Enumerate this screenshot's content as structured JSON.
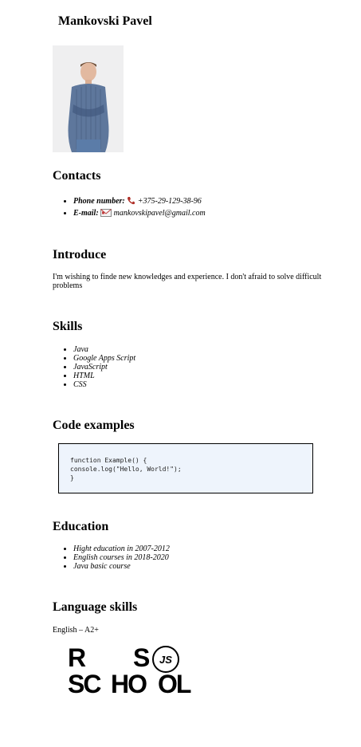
{
  "name": "Mankovski Pavel",
  "contacts": {
    "heading": "Contacts",
    "phone_label": "Phone number:",
    "phone_value": "+375-29-129-38-96",
    "email_label": "E-mail:",
    "email_value": "mankovskipavel@gmail.com"
  },
  "introduce": {
    "heading": "Introduce",
    "text": "I'm wishing to finde new knowledges and experience. I don't afraid to solve difficult problems"
  },
  "skills": {
    "heading": "Skills",
    "items": [
      "Java",
      "Google Apps Script",
      "JavaScript",
      "HTML",
      "CSS"
    ]
  },
  "code_examples": {
    "heading": "Code examples",
    "lines": [
      "function Example() {",
      "console.log(\"Hello, World!\");",
      "}"
    ]
  },
  "education": {
    "heading": "Education",
    "items": [
      "Hight education in 2007-2012",
      "English courses in 2018-2020",
      "Java basic course"
    ]
  },
  "language": {
    "heading": "Language skills",
    "text": "English – A2+"
  },
  "logo": {
    "row1_left": "R",
    "row1_right": "S",
    "badge": "JS",
    "row2_a": "SC",
    "row2_b": "HO",
    "row2_c": "OL"
  }
}
